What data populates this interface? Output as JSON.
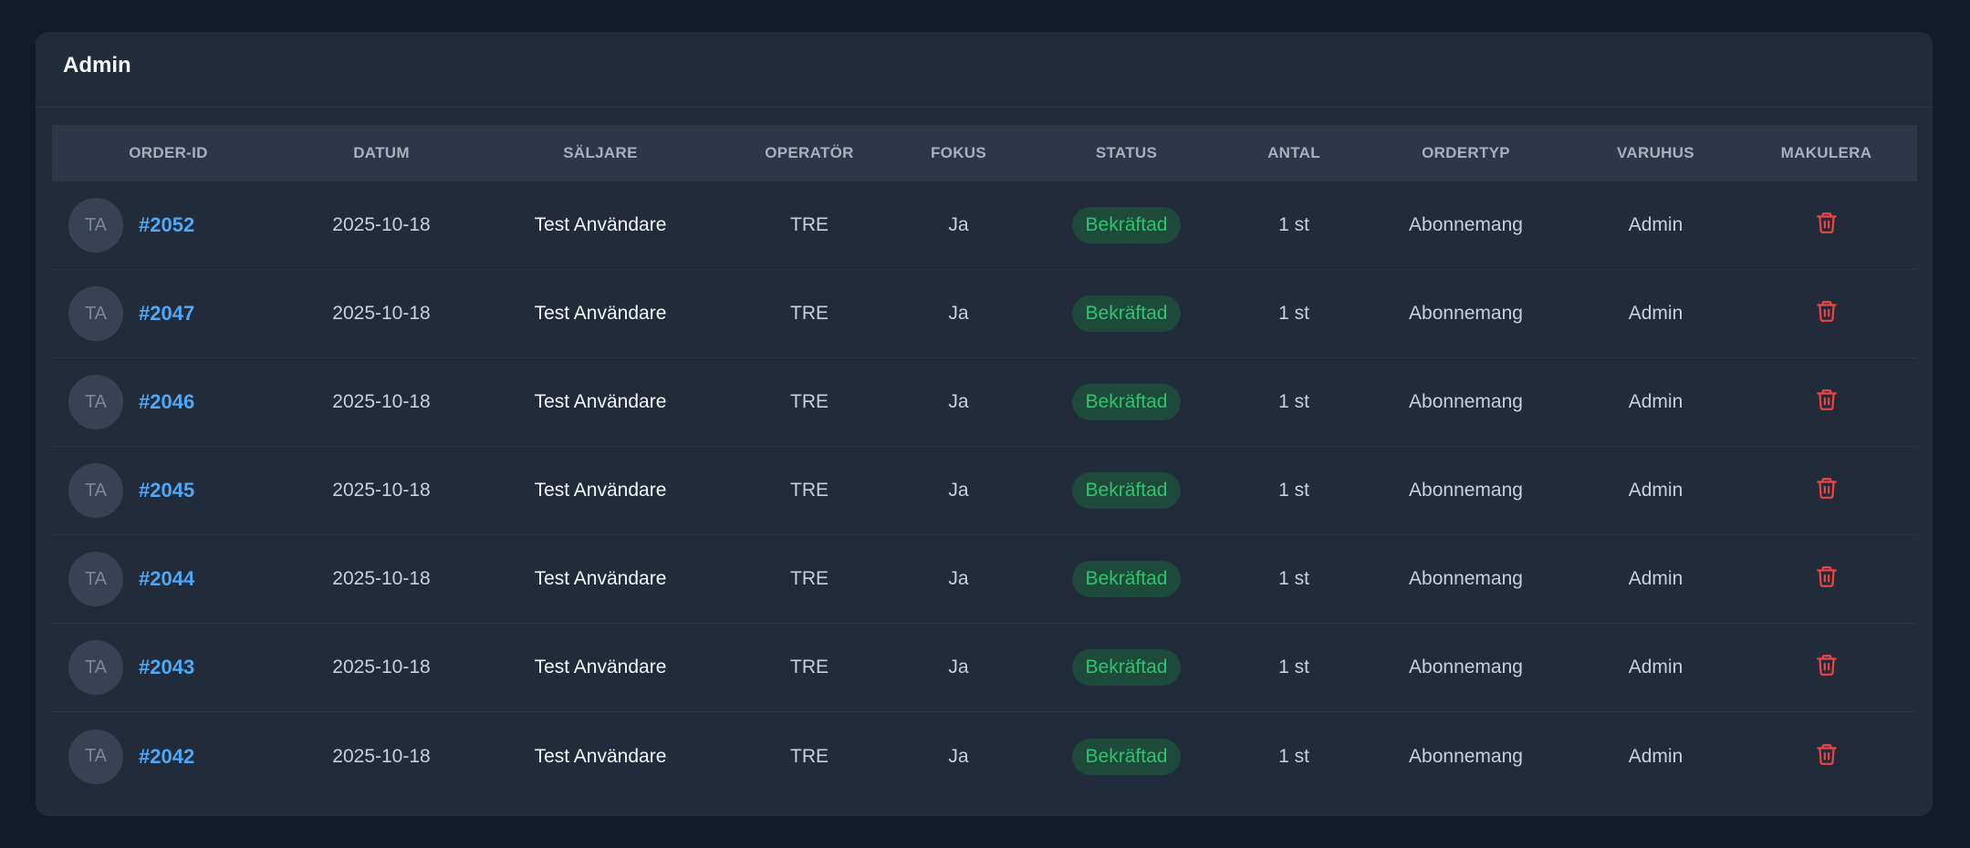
{
  "card": {
    "title": "Admin"
  },
  "table": {
    "columns": [
      "ORDER-ID",
      "DATUM",
      "SÄLJARE",
      "OPERATÖR",
      "FOKUS",
      "STATUS",
      "ANTAL",
      "ORDERTYP",
      "VARUHUS",
      "MAKULERA"
    ],
    "rows": [
      {
        "initials": "TA",
        "order_id": "#2052",
        "date": "2025-10-18",
        "seller": "Test Användare",
        "operator": "TRE",
        "focus": "Ja",
        "status": "Bekräftad",
        "quantity": "1 st",
        "order_type": "Abonnemang",
        "store": "Admin"
      },
      {
        "initials": "TA",
        "order_id": "#2047",
        "date": "2025-10-18",
        "seller": "Test Användare",
        "operator": "TRE",
        "focus": "Ja",
        "status": "Bekräftad",
        "quantity": "1 st",
        "order_type": "Abonnemang",
        "store": "Admin"
      },
      {
        "initials": "TA",
        "order_id": "#2046",
        "date": "2025-10-18",
        "seller": "Test Användare",
        "operator": "TRE",
        "focus": "Ja",
        "status": "Bekräftad",
        "quantity": "1 st",
        "order_type": "Abonnemang",
        "store": "Admin"
      },
      {
        "initials": "TA",
        "order_id": "#2045",
        "date": "2025-10-18",
        "seller": "Test Användare",
        "operator": "TRE",
        "focus": "Ja",
        "status": "Bekräftad",
        "quantity": "1 st",
        "order_type": "Abonnemang",
        "store": "Admin"
      },
      {
        "initials": "TA",
        "order_id": "#2044",
        "date": "2025-10-18",
        "seller": "Test Användare",
        "operator": "TRE",
        "focus": "Ja",
        "status": "Bekräftad",
        "quantity": "1 st",
        "order_type": "Abonnemang",
        "store": "Admin"
      },
      {
        "initials": "TA",
        "order_id": "#2043",
        "date": "2025-10-18",
        "seller": "Test Användare",
        "operator": "TRE",
        "focus": "Ja",
        "status": "Bekräftad",
        "quantity": "1 st",
        "order_type": "Abonnemang",
        "store": "Admin"
      },
      {
        "initials": "TA",
        "order_id": "#2042",
        "date": "2025-10-18",
        "seller": "Test Användare",
        "operator": "TRE",
        "focus": "Ja",
        "status": "Bekräftad",
        "quantity": "1 st",
        "order_type": "Abonnemang",
        "store": "Admin"
      }
    ]
  },
  "icons": {
    "delete": "trash-icon"
  },
  "colors": {
    "background": "#131a29",
    "card": "#222b3a",
    "header_row": "#2d3748",
    "link": "#4ea8f5",
    "status_bg": "#1d4a3a",
    "status_text": "#2fc46e",
    "danger": "#ef4444"
  }
}
